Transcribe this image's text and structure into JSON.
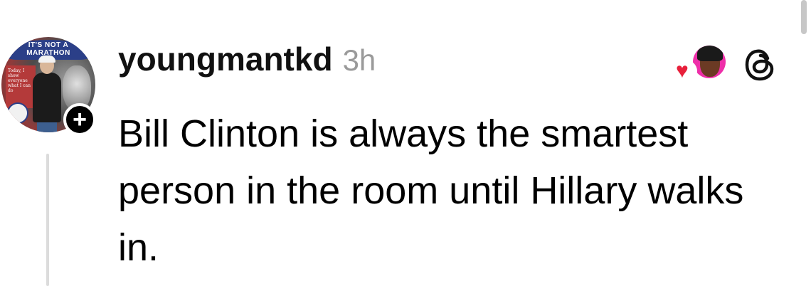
{
  "post": {
    "username": "youngmantkd",
    "timestamp": "3h",
    "text": "Bill Clinton is always the smartest person in the room until Hillary walks in."
  },
  "avatar": {
    "banner_text": "IT'S NOT A MARATHON",
    "card_text": "Today, I show everyone what I can do"
  },
  "follow_button": {
    "label": "+"
  },
  "icons": {
    "follow": "plus-icon",
    "like": "heart-icon",
    "app": "threads-logo-icon"
  },
  "colors": {
    "username": "#111111",
    "timestamp": "#9a9a9a",
    "heart": "#e8203b",
    "reply_avatar_bg": "#ee2fa9",
    "thread_line": "#dcdcdc"
  }
}
